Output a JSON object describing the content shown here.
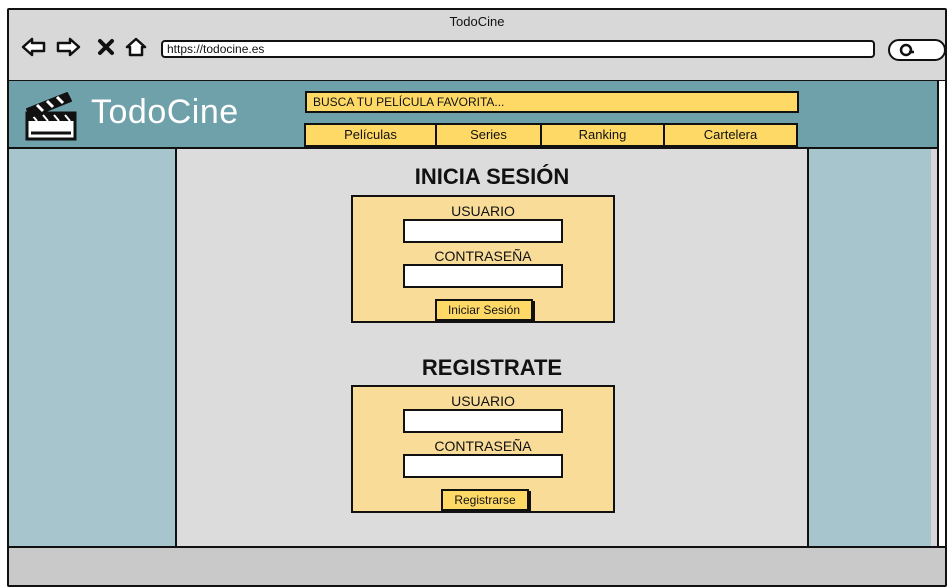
{
  "browser": {
    "window_title": "TodoCine",
    "url": "https://todocine.es",
    "icons": [
      "back-arrow-icon",
      "forward-arrow-icon",
      "close-x-icon",
      "home-icon",
      "search-icon"
    ]
  },
  "site": {
    "logo_text": "TodoCine",
    "search_placeholder": "BUSCA TU PELÍCULA FAVORITA...",
    "tabs": [
      "Películas",
      "Series",
      "Ranking",
      "Cartelera"
    ]
  },
  "login": {
    "title": "INICIA SESIÓN",
    "user_label": "USUARIO",
    "user_value": "",
    "password_label": "CONTRASEÑA",
    "password_value": "",
    "button": "Iniciar Sesión"
  },
  "register": {
    "title": "REGISTRATE",
    "user_label": "USUARIO",
    "user_value": "",
    "password_label": "CONTRASEÑA",
    "password_value": "",
    "button": "Registrarse"
  },
  "colors": {
    "header": "#6fa1ab",
    "side_columns": "#a6c5cc",
    "accent_yellow": "#ffd966",
    "form_bg": "#f9dc98",
    "content_bg": "#dcdcdc"
  }
}
